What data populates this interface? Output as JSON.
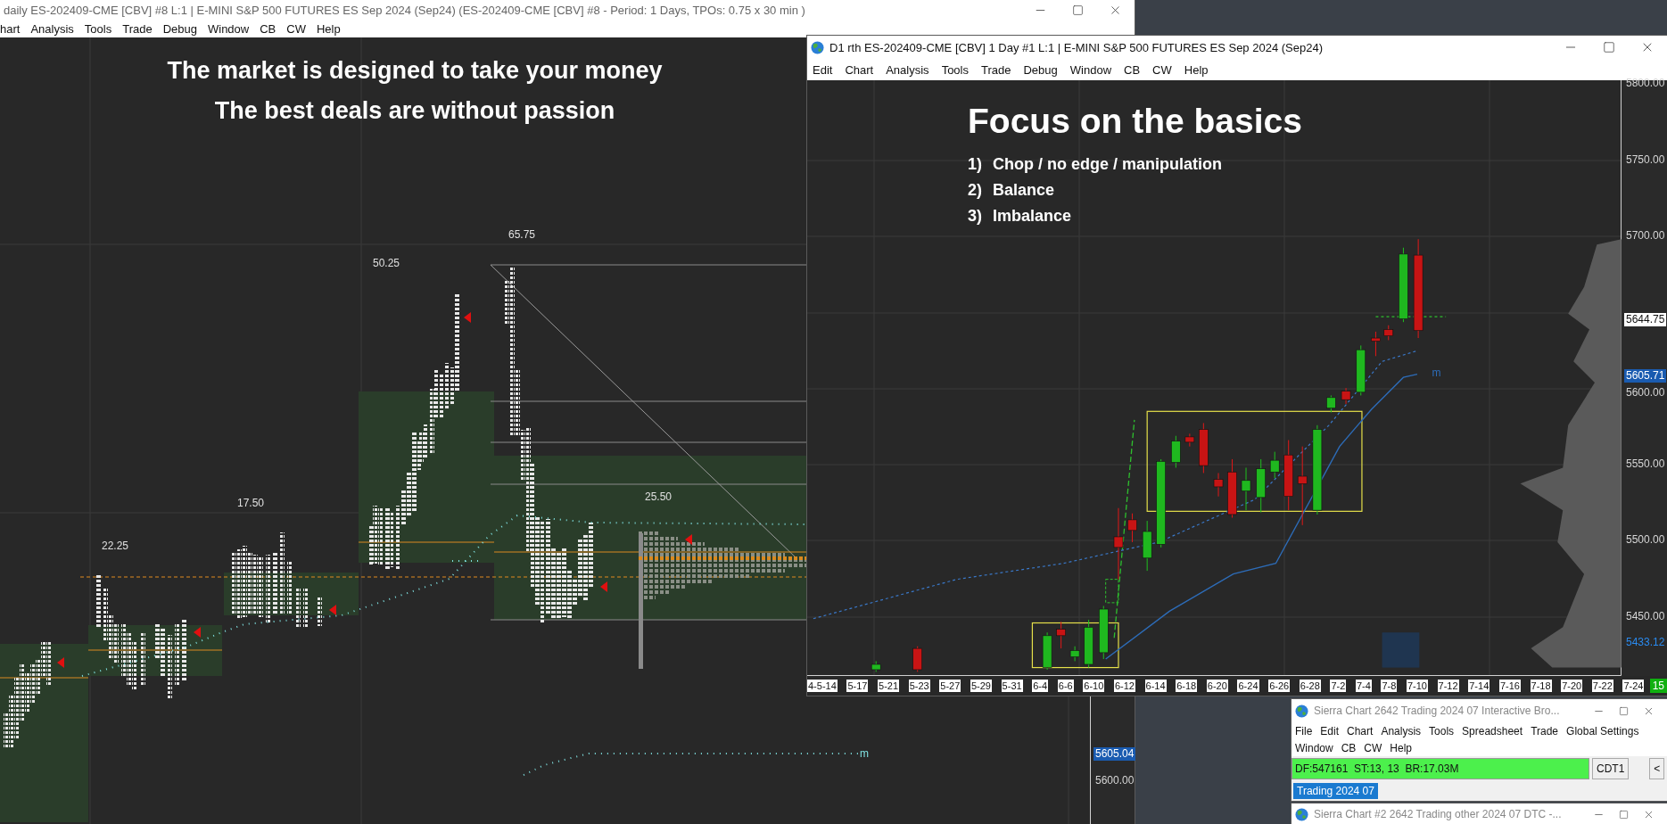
{
  "main_window": {
    "title": "daily ES-202409-CME [CBV] #8 L:1 | E-MINI S&P 500 FUTURES ES Sep 2024 (Sep24) (ES-202409-CME [CBV] #8 - Period: 1 Days, TPOs: 0.75 x 30 min )",
    "menu": [
      "hart",
      "Analysis",
      "Tools",
      "Trade",
      "Debug",
      "Window",
      "CB",
      "CW",
      "Help"
    ],
    "headlines": [
      "The market is designed to take your money",
      "The best deals are without passion"
    ],
    "range_labels": [
      "65.75",
      "50.25",
      "17.50",
      "22.25",
      "25.50"
    ],
    "line_label": "m",
    "price_axis": [
      {
        "text": "5605.04",
        "kind": "current"
      },
      {
        "text": "5600.00",
        "kind": "tick"
      }
    ]
  },
  "chart_window": {
    "title": "D1 rth ES-202409-CME [CBV]  1 Day  #1 L:1 | E-MINI S&P 500 FUTURES ES Sep 2024 (Sep24)",
    "menu": [
      "Edit",
      "Chart",
      "Analysis",
      "Tools",
      "Trade",
      "Debug",
      "Window",
      "CB",
      "CW",
      "Help"
    ],
    "heading": "Focus on the basics",
    "points": [
      {
        "number": "1)",
        "text": "Chop / no edge / manipulation"
      },
      {
        "number": "2)",
        "text": "Balance"
      },
      {
        "number": "3)",
        "text": "Imbalance"
      }
    ],
    "line_label": "m",
    "price_axis": [
      {
        "text": "5800.00",
        "kind": "tick"
      },
      {
        "text": "5750.00",
        "kind": "tick"
      },
      {
        "text": "5700.00",
        "kind": "tick"
      },
      {
        "text": "5644.75",
        "kind": "last"
      },
      {
        "text": "5605.71",
        "kind": "current"
      },
      {
        "text": "5600.00",
        "kind": "tick"
      },
      {
        "text": "5550.00",
        "kind": "tick"
      },
      {
        "text": "5500.00",
        "kind": "tick"
      },
      {
        "text": "5450.00",
        "kind": "tick"
      },
      {
        "text": "5433.12",
        "kind": "line"
      }
    ],
    "dates": [
      "4-5-14",
      "5-17",
      "5-21",
      "5-23",
      "5-27",
      "5-29",
      "5-31",
      "6-4",
      "6-6",
      "6-10",
      "6-12",
      "6-14",
      "6-18",
      "6-20",
      "6-24",
      "6-26",
      "6-28",
      "7-2",
      "7-4",
      "7-8",
      "7-10",
      "7-12",
      "7-14",
      "7-16",
      "7-18",
      "7-20",
      "7-22",
      "7-24"
    ],
    "badge": "15"
  },
  "trade_window": {
    "title": "Sierra Chart 2642 Trading 2024 07 Interactive Bro...",
    "menu_rows": [
      [
        "File",
        "Edit",
        "Chart",
        "Analysis",
        "Tools",
        "Spreadsheet",
        "Trade",
        "Global Settings"
      ],
      [
        "Window",
        "CB",
        "CW",
        "Help"
      ]
    ],
    "status": "DF:547161  ST:13, 13  BR:17.03M",
    "buttons": [
      "CDT1",
      "<"
    ],
    "tabs": [
      {
        "label": "Trading 2024 07",
        "selected": true
      }
    ]
  },
  "second_window": {
    "title": "Sierra Chart #2 2642 Trading other 2024 07 DTC -..."
  }
}
